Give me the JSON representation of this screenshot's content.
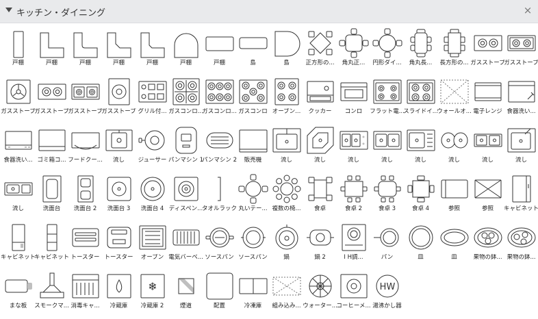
{
  "panel": {
    "title": "キッチン・ダイニング",
    "close_glyph": "×"
  },
  "items": [
    {
      "label": "戸棚",
      "icon": "cabinet-tall"
    },
    {
      "label": "戸棚",
      "icon": "cabinet-l"
    },
    {
      "label": "戸棚",
      "icon": "cabinet-l-round"
    },
    {
      "label": "戸棚",
      "icon": "cabinet-l-chamfer"
    },
    {
      "label": "戸棚",
      "icon": "cabinet-l-chamfer2"
    },
    {
      "label": "戸棚",
      "icon": "cabinet-arch"
    },
    {
      "label": "戸棚",
      "icon": "cabinet-wide"
    },
    {
      "label": "島",
      "icon": "island-round"
    },
    {
      "label": "島",
      "icon": "island-d"
    },
    {
      "label": "正方形の...",
      "icon": "square-table-diamond"
    },
    {
      "label": "角丸正...",
      "icon": "rounded-square-table"
    },
    {
      "label": "円形ダイ...",
      "icon": "round-dining-table"
    },
    {
      "label": "角丸長...",
      "icon": "rounded-long-table"
    },
    {
      "label": "長方形の...",
      "icon": "rect-table"
    },
    {
      "label": "ガスストーブ",
      "icon": "gas-stove-2"
    },
    {
      "label": "ガスストーブ",
      "icon": "gas-stove-2b"
    },
    {
      "label": "ガスストーブ",
      "icon": "gas-stove-fan"
    },
    {
      "label": "ガスストーブ",
      "icon": "gas-stove-oval"
    },
    {
      "label": "ガスストーブ",
      "icon": "gas-stove-2-burner"
    },
    {
      "label": "ガスストーブ",
      "icon": "gas-stove-single"
    },
    {
      "label": "グリル付...",
      "icon": "grill-stove"
    },
    {
      "label": "ガスコンロ...",
      "icon": "gas-range-4"
    },
    {
      "label": "ガスコンロ...",
      "icon": "gas-range-6"
    },
    {
      "label": "ガスコンロ",
      "icon": "gas-range"
    },
    {
      "label": "オーブン...",
      "icon": "oven-range"
    },
    {
      "label": "クッカー",
      "icon": "cooker"
    },
    {
      "label": "コンロ",
      "icon": "stove"
    },
    {
      "label": "フラット電...",
      "icon": "flat-electric"
    },
    {
      "label": "スライドイ...",
      "icon": "slide-in"
    },
    {
      "label": "ウォールオ...",
      "icon": "wall-oven"
    },
    {
      "label": "電子レンジ",
      "icon": "microwave"
    },
    {
      "label": "食器洗い...",
      "icon": "dishwasher"
    },
    {
      "label": "食器洗い...",
      "icon": "dishwasher-2"
    },
    {
      "label": "ゴミ箱コ...",
      "icon": "trash-compactor"
    },
    {
      "label": "フードクー...",
      "icon": "range-hood"
    },
    {
      "label": "流し",
      "icon": "sink-single"
    },
    {
      "label": "ジューサー",
      "icon": "juicer"
    },
    {
      "label": "パンマシン 1",
      "icon": "bread-machine-1"
    },
    {
      "label": "パンマシン 2",
      "icon": "bread-machine-2"
    },
    {
      "label": "販売機",
      "icon": "vending-machine"
    },
    {
      "label": "流し",
      "icon": "sink-counter"
    },
    {
      "label": "流し",
      "icon": "sink-corner"
    },
    {
      "label": "流し",
      "icon": "sink-double-drain"
    },
    {
      "label": "流し",
      "icon": "sink-double"
    },
    {
      "label": "流し",
      "icon": "sink-drainboard"
    },
    {
      "label": "流し",
      "icon": "sink-round-double"
    },
    {
      "label": "流し",
      "icon": "sink-small-double"
    },
    {
      "label": "流し",
      "icon": "sink-basin"
    },
    {
      "label": "流し",
      "icon": "sink-bar"
    },
    {
      "label": "洗面台",
      "icon": "washbasin"
    },
    {
      "label": "洗面台 2",
      "icon": "washbasin-2"
    },
    {
      "label": "洗面台 3",
      "icon": "washbasin-3"
    },
    {
      "label": "洗面台 4",
      "icon": "washbasin-4"
    },
    {
      "label": "ディスペン...",
      "icon": "dispenser"
    },
    {
      "label": "タオルラック",
      "icon": "towel-rack"
    },
    {
      "label": "丸いテー...",
      "icon": "round-table-4"
    },
    {
      "label": "複数の椅...",
      "icon": "multi-chairs"
    },
    {
      "label": "食卓",
      "icon": "dining-table"
    },
    {
      "label": "食卓 2",
      "icon": "dining-table-2"
    },
    {
      "label": "食卓 3",
      "icon": "dining-table-3"
    },
    {
      "label": "食卓 4",
      "icon": "dining-table-4"
    },
    {
      "label": "参照",
      "icon": "reference-rect"
    },
    {
      "label": "参照",
      "icon": "reference-x"
    },
    {
      "label": "キャビネット",
      "icon": "cabinet-side"
    },
    {
      "label": "キャビネット",
      "icon": "cabinet-v1"
    },
    {
      "label": "キャビネット",
      "icon": "cabinet-v2"
    },
    {
      "label": "トースター",
      "icon": "toaster"
    },
    {
      "label": "トースター",
      "icon": "toaster-2"
    },
    {
      "label": "オーブン",
      "icon": "oven"
    },
    {
      "label": "電気バーベ...",
      "icon": "electric-bbq"
    },
    {
      "label": "ソースパン",
      "icon": "saucepan"
    },
    {
      "label": "ソースパン",
      "icon": "saucepan-2"
    },
    {
      "label": "鍋",
      "icon": "pot"
    },
    {
      "label": "鍋 2",
      "icon": "pot-2"
    },
    {
      "label": "I H調...",
      "icon": "ih-cooker"
    },
    {
      "label": "パン",
      "icon": "pan"
    },
    {
      "label": "皿",
      "icon": "plate-round"
    },
    {
      "label": "皿",
      "icon": "plate-oval"
    },
    {
      "label": "果物の鉢...",
      "icon": "fruit-bowl"
    },
    {
      "label": "果物の鉢...",
      "icon": "fruit-bowl-2"
    },
    {
      "label": "まな板",
      "icon": "cutting-board"
    },
    {
      "label": "スモークマ...",
      "icon": "smoke-machine"
    },
    {
      "label": "消毒キャ...",
      "icon": "sterilizer-cabinet"
    },
    {
      "label": "冷蔵庫",
      "icon": "refrigerator"
    },
    {
      "label": "冷蔵庫 2",
      "icon": "refrigerator-2"
    },
    {
      "label": "煙道",
      "icon": "flue"
    },
    {
      "label": "配置",
      "icon": "placement"
    },
    {
      "label": "冷凍庫",
      "icon": "freezer"
    },
    {
      "label": "組み込み...",
      "icon": "built-in"
    },
    {
      "label": "ウォーター...",
      "icon": "water-heater"
    },
    {
      "label": "コーヒーメ...",
      "icon": "coffee-maker"
    },
    {
      "label": "湯沸かし器",
      "icon": "hw-boiler",
      "glyph": "HW"
    }
  ]
}
